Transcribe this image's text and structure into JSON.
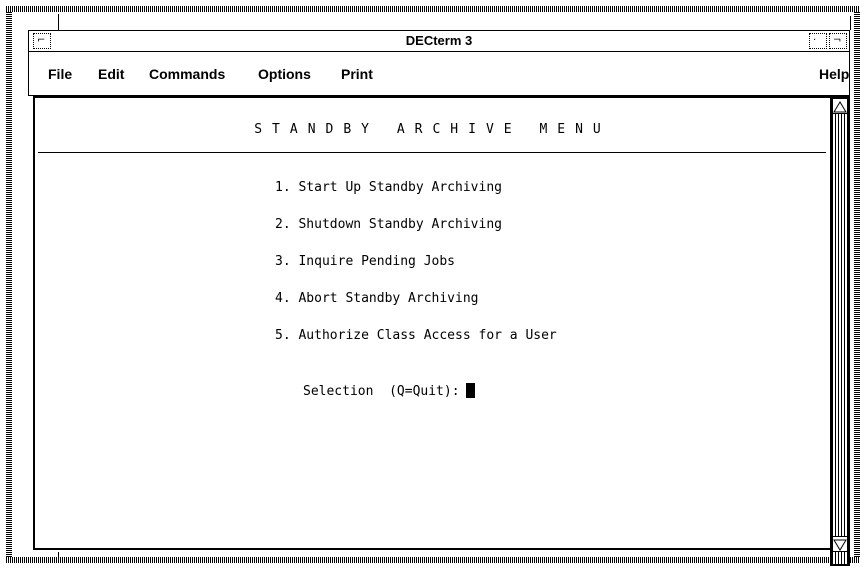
{
  "window": {
    "title": "DECterm 3"
  },
  "menu": {
    "file": "File",
    "edit": "Edit",
    "commands": "Commands",
    "options": "Options",
    "print": "Print",
    "help": "Help"
  },
  "terminal": {
    "menu_title": "STANDBY ARCHIVE MENU",
    "options": [
      "1. Start Up Standby Archiving",
      "2. Shutdown Standby Archiving",
      "3. Inquire Pending Jobs",
      "4. Abort Standby Archiving",
      "5. Authorize Class Access for a User"
    ],
    "prompt": "Selection  (Q=Quit):"
  },
  "icons": {
    "window_menu": "window-menu-icon",
    "minimize": "minimize-icon",
    "maximize": "maximize-icon",
    "scroll_up": "scroll-up-arrow-icon",
    "scroll_down": "scroll-down-arrow-icon"
  }
}
